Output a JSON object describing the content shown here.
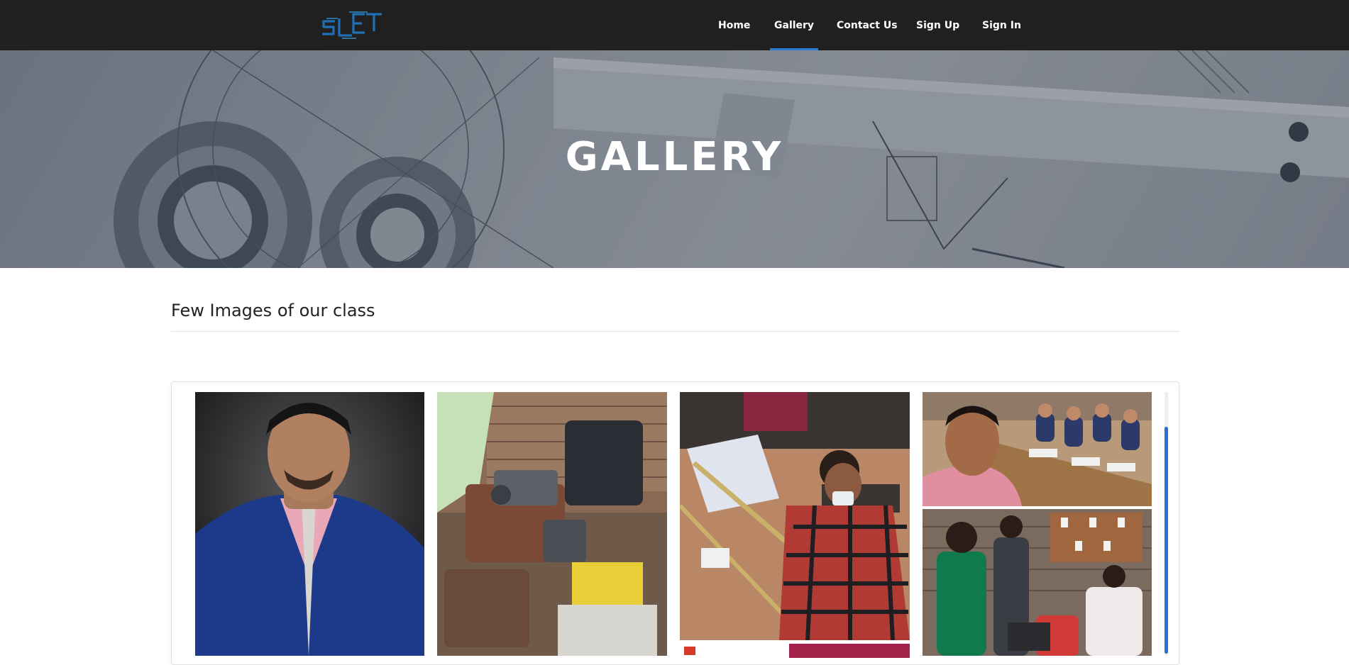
{
  "nav": {
    "logo_text": "SLET",
    "items": [
      {
        "label": "Home",
        "active": false
      },
      {
        "label": "Gallery",
        "active": true
      },
      {
        "label": "Contact Us",
        "active": false
      },
      {
        "label": "Sign Up",
        "active": false
      },
      {
        "label": "Sign In",
        "active": false
      }
    ],
    "active_color": "#2d7bd6"
  },
  "hero": {
    "title": "GALLERY"
  },
  "section": {
    "title": "Few Images of our class"
  },
  "gallery": {
    "images": [
      {
        "name": "student-portrait-photo"
      },
      {
        "name": "engine-parts-workshop-photo"
      },
      {
        "name": "student-wiring-board-photo"
      },
      {
        "name": "classroom-selfie-photo"
      },
      {
        "name": "students-electrical-lab-photo"
      },
      {
        "name": "poster-thumbnail-photo"
      }
    ]
  },
  "colors": {
    "navbar_bg": "#202020",
    "accent": "#2d7bd6"
  }
}
